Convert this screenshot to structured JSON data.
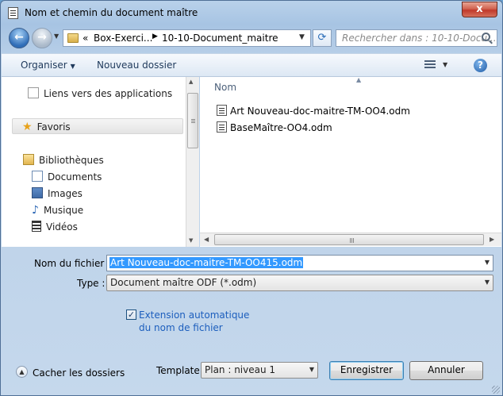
{
  "window": {
    "title": "Nom et chemin du document maître",
    "close_label": "x"
  },
  "address": {
    "prefix": "«",
    "crumbs": [
      "Box-Exerci...",
      "10-10-Document_maitre"
    ],
    "search_placeholder": "Rechercher dans : 10-10-Docu..."
  },
  "toolbar": {
    "organize_label": "Organiser",
    "new_folder_label": "Nouveau dossier"
  },
  "nav": {
    "items": [
      {
        "label": "Liens vers des applications",
        "icon": "document-icon"
      },
      {
        "label": "Favoris",
        "icon": "star-icon"
      },
      {
        "label": "Bibliothèques",
        "icon": "library-icon"
      },
      {
        "label": "Documents",
        "icon": "documents-icon"
      },
      {
        "label": "Images",
        "icon": "images-icon"
      },
      {
        "label": "Musique",
        "icon": "music-icon"
      },
      {
        "label": "Vidéos",
        "icon": "video-icon"
      }
    ]
  },
  "files": {
    "column_header": "Nom",
    "items": [
      {
        "name": "Art Nouveau-doc-maitre-TM-OO4.odm"
      },
      {
        "name": "BaseMaître-OO4.odm"
      }
    ]
  },
  "form": {
    "filename_label": "Nom du fichier :",
    "filename_value": "Art Nouveau-doc-maitre-TM-OO415.odm",
    "type_label": "Type :",
    "type_value": "Document maître ODF (*.odm)",
    "auto_extension_label": "Extension automatique du nom de fichier",
    "auto_extension_checked": true,
    "hide_folders_label": "Cacher les dossiers",
    "template_label": "Template",
    "template_value": "Plan : niveau 1",
    "save_label": "Enregistrer",
    "cancel_label": "Annuler"
  }
}
